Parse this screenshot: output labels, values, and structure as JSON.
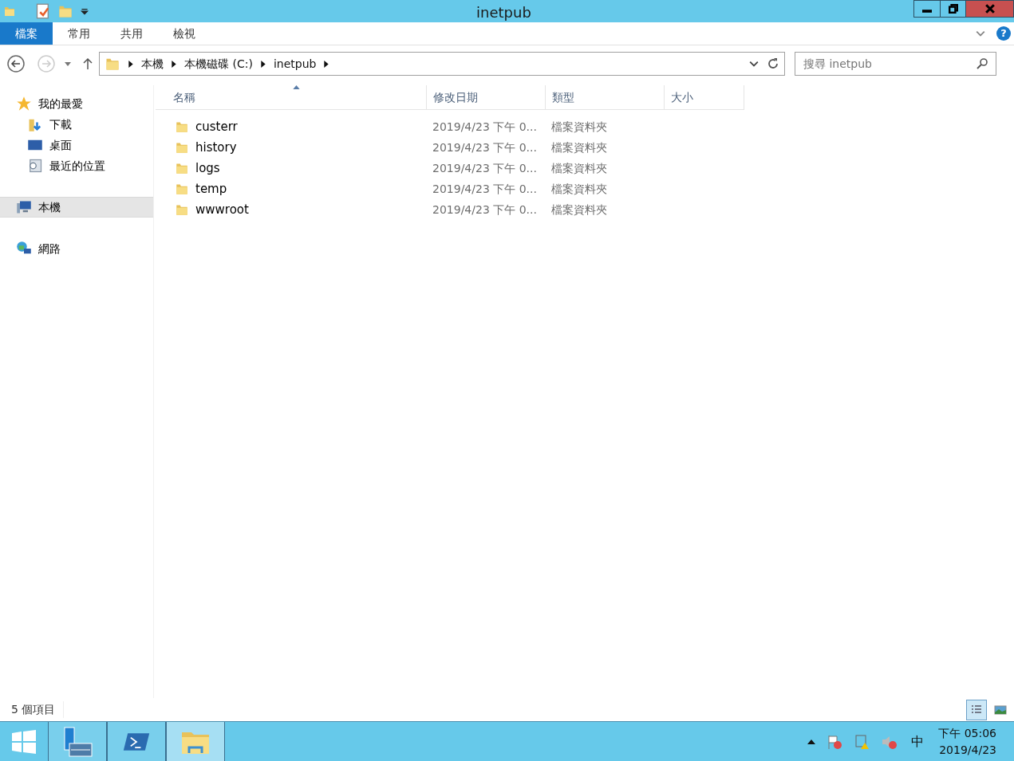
{
  "window": {
    "title": "inetpub"
  },
  "ribbon": {
    "help": "?",
    "tabs": [
      {
        "label": "檔案",
        "selected": true
      },
      {
        "label": "常用",
        "selected": false
      },
      {
        "label": "共用",
        "selected": false
      },
      {
        "label": "檢視",
        "selected": false
      }
    ]
  },
  "address": {
    "breadcrumbs": [
      "本機",
      "本機磁碟 (C:)",
      "inetpub"
    ]
  },
  "search": {
    "placeholder": "搜尋 inetpub"
  },
  "nav": {
    "items": [
      {
        "label": "我的最愛",
        "kind": "star",
        "selected": false,
        "children": [
          {
            "label": "下載",
            "kind": "download",
            "selected": false
          },
          {
            "label": "桌面",
            "kind": "desktop",
            "selected": false
          },
          {
            "label": "最近的位置",
            "kind": "recent",
            "selected": false
          }
        ]
      },
      {
        "label": "本機",
        "kind": "computer",
        "selected": true
      },
      {
        "label": "網路",
        "kind": "network",
        "selected": false
      }
    ]
  },
  "table": {
    "columns": [
      {
        "label": "名稱",
        "sorted": true
      },
      {
        "label": "修改日期",
        "sorted": false
      },
      {
        "label": "類型",
        "sorted": false
      },
      {
        "label": "大小",
        "sorted": false
      }
    ],
    "rows": [
      {
        "name": "custerr",
        "date": "2019/4/23 下午 0...",
        "type": "檔案資料夾"
      },
      {
        "name": "history",
        "date": "2019/4/23 下午 0...",
        "type": "檔案資料夾"
      },
      {
        "name": "logs",
        "date": "2019/4/23 下午 0...",
        "type": "檔案資料夾"
      },
      {
        "name": "temp",
        "date": "2019/4/23 下午 0...",
        "type": "檔案資料夾"
      },
      {
        "name": "wwwroot",
        "date": "2019/4/23 下午 0...",
        "type": "檔案資料夾"
      }
    ]
  },
  "status_bar": {
    "text": "5 個項目",
    "views": [
      {
        "kind": "details",
        "selected": true
      },
      {
        "kind": "thumbnails",
        "selected": false
      }
    ]
  },
  "taskbar": {
    "apps": [
      {
        "kind": "start",
        "selected": false
      },
      {
        "kind": "server",
        "selected": false
      },
      {
        "kind": "shell",
        "selected": false
      },
      {
        "kind": "explorer",
        "selected": true
      }
    ],
    "ime": "中",
    "time": "下午 05:06",
    "date": "2019/4/23"
  }
}
